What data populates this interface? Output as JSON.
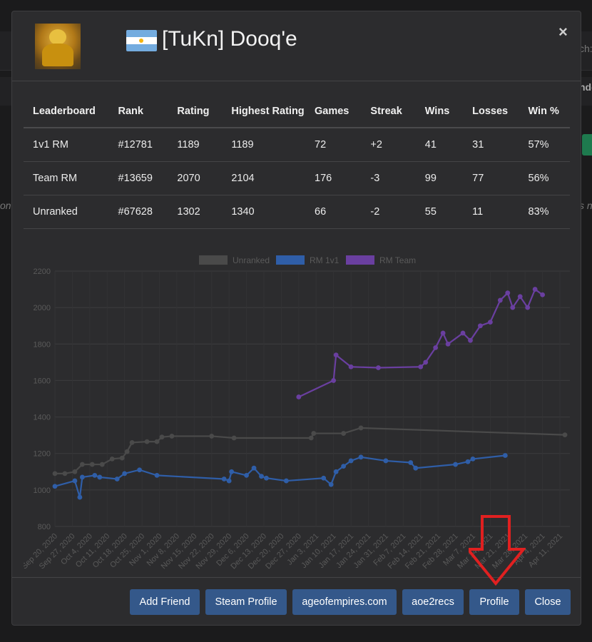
{
  "background": {
    "right_top": "ch:",
    "right_mid": "nde",
    "left_text": "on.",
    "right_text": "s no"
  },
  "modal": {
    "player_name": "[TuKn] Dooq'e",
    "close_icon": "×",
    "stats_table": {
      "headers": [
        "Leaderboard",
        "Rank",
        "Rating",
        "Highest Rating",
        "Games",
        "Streak",
        "Wins",
        "Losses",
        "Win %"
      ],
      "rows": [
        [
          "1v1 RM",
          "#12781",
          "1189",
          "1189",
          "72",
          "+2",
          "41",
          "31",
          "57%"
        ],
        [
          "Team RM",
          "#13659",
          "2070",
          "2104",
          "176",
          "-3",
          "99",
          "77",
          "56%"
        ],
        [
          "Unranked",
          "#67628",
          "1302",
          "1340",
          "66",
          "-2",
          "55",
          "11",
          "83%"
        ]
      ]
    },
    "footer_buttons": [
      {
        "label": "Add Friend"
      },
      {
        "label": "Steam Profile"
      },
      {
        "label": "ageofempires.com"
      },
      {
        "label": "aoe2recs"
      },
      {
        "label": "Profile"
      },
      {
        "label": "Close"
      }
    ]
  },
  "colors": {
    "unranked": "#4a4a4a",
    "rm_1v1": "#2f5ea8",
    "rm_team": "#6a3fa0",
    "arrow": "#e02020"
  },
  "chart_data": {
    "type": "line",
    "legend_position": "top",
    "ylim": [
      800,
      2200
    ],
    "yticks": [
      800,
      1000,
      1200,
      1400,
      1600,
      1800,
      2000,
      2200
    ],
    "xticks": [
      "Sep 20, 2020",
      "Sep 27, 2020",
      "Oct 4, 2020",
      "Oct 11, 2020",
      "Oct 18, 2020",
      "Oct 25, 2020",
      "Nov 1, 2020",
      "Nov 8, 2020",
      "Nov 15, 2020",
      "Nov 22, 2020",
      "Nov 29, 2020",
      "Dec 6, 2020",
      "Dec 13, 2020",
      "Dec 20, 2020",
      "Dec 27, 2020",
      "Jan 3, 2021",
      "Jan 10, 2021",
      "Jan 17, 2021",
      "Jan 24, 2021",
      "Jan 31, 2021",
      "Feb 7, 2021",
      "Feb 14, 2021",
      "Feb 21, 2021",
      "Feb 28, 2021",
      "Mar 7, 2021",
      "Mar 14, 2021",
      "Mar 21, 2021",
      "Mar 28, 2021",
      "Apr 4, 2021",
      "Apr 11, 2021"
    ],
    "x_start": "2020-09-20",
    "x_end": "2021-04-15",
    "series": [
      {
        "name": "Unranked",
        "points": [
          [
            "2020-09-20",
            1090
          ],
          [
            "2020-09-24",
            1090
          ],
          [
            "2020-09-28",
            1100
          ],
          [
            "2020-10-01",
            1140
          ],
          [
            "2020-10-05",
            1140
          ],
          [
            "2020-10-09",
            1140
          ],
          [
            "2020-10-13",
            1170
          ],
          [
            "2020-10-17",
            1175
          ],
          [
            "2020-10-19",
            1210
          ],
          [
            "2020-10-21",
            1260
          ],
          [
            "2020-10-27",
            1265
          ],
          [
            "2020-10-31",
            1265
          ],
          [
            "2020-11-02",
            1290
          ],
          [
            "2020-11-06",
            1295
          ],
          [
            "2020-11-22",
            1295
          ],
          [
            "2020-12-01",
            1285
          ],
          [
            "2021-01-01",
            1285
          ],
          [
            "2021-01-02",
            1310
          ],
          [
            "2021-01-14",
            1310
          ],
          [
            "2021-01-21",
            1340
          ],
          [
            "2021-04-13",
            1302
          ]
        ]
      },
      {
        "name": "RM 1v1",
        "points": [
          [
            "2020-09-20",
            1020
          ],
          [
            "2020-09-28",
            1050
          ],
          [
            "2020-09-30",
            960
          ],
          [
            "2020-10-01",
            1070
          ],
          [
            "2020-10-06",
            1080
          ],
          [
            "2020-10-08",
            1070
          ],
          [
            "2020-10-15",
            1060
          ],
          [
            "2020-10-18",
            1090
          ],
          [
            "2020-10-24",
            1110
          ],
          [
            "2020-10-31",
            1080
          ],
          [
            "2020-11-27",
            1060
          ],
          [
            "2020-11-29",
            1050
          ],
          [
            "2020-11-30",
            1100
          ],
          [
            "2020-12-06",
            1080
          ],
          [
            "2020-12-09",
            1120
          ],
          [
            "2020-12-12",
            1075
          ],
          [
            "2020-12-14",
            1065
          ],
          [
            "2020-12-22",
            1050
          ],
          [
            "2021-01-06",
            1065
          ],
          [
            "2021-01-09",
            1030
          ],
          [
            "2021-01-11",
            1100
          ],
          [
            "2021-01-14",
            1130
          ],
          [
            "2021-01-17",
            1160
          ],
          [
            "2021-01-21",
            1180
          ],
          [
            "2021-01-31",
            1160
          ],
          [
            "2021-02-10",
            1150
          ],
          [
            "2021-02-12",
            1120
          ],
          [
            "2021-02-28",
            1140
          ],
          [
            "2021-03-05",
            1155
          ],
          [
            "2021-03-07",
            1170
          ],
          [
            "2021-03-20",
            1189
          ]
        ]
      },
      {
        "name": "RM Team",
        "points": [
          [
            "2020-12-27",
            1510
          ],
          [
            "2021-01-10",
            1600
          ],
          [
            "2021-01-11",
            1740
          ],
          [
            "2021-01-17",
            1675
          ],
          [
            "2021-01-28",
            1670
          ],
          [
            "2021-02-14",
            1675
          ],
          [
            "2021-02-16",
            1700
          ],
          [
            "2021-02-20",
            1780
          ],
          [
            "2021-02-23",
            1860
          ],
          [
            "2021-02-25",
            1800
          ],
          [
            "2021-03-03",
            1860
          ],
          [
            "2021-03-06",
            1820
          ],
          [
            "2021-03-10",
            1900
          ],
          [
            "2021-03-14",
            1920
          ],
          [
            "2021-03-18",
            2040
          ],
          [
            "2021-03-21",
            2080
          ],
          [
            "2021-03-23",
            2000
          ],
          [
            "2021-03-26",
            2060
          ],
          [
            "2021-03-29",
            2000
          ],
          [
            "2021-04-01",
            2100
          ],
          [
            "2021-04-04",
            2070
          ]
        ]
      }
    ]
  }
}
